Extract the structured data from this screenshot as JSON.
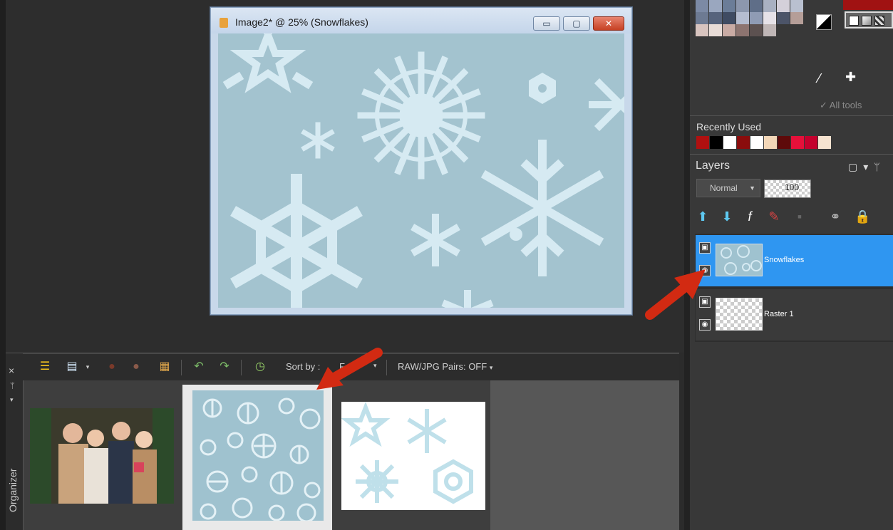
{
  "image_window": {
    "title": "Image2* @  25% (Snowflakes)",
    "min_glyph": "▭",
    "max_glyph": "▢",
    "close_glyph": "✕"
  },
  "palette": {
    "swatches": [
      "#7c8aa5",
      "#9aa7bf",
      "#6b7d98",
      "#8c97ad",
      "#5f6e88",
      "#a9b1c2",
      "#d4d0da",
      "#b9c0d0",
      "#6d7a92",
      "#56637c",
      "#3f4b62",
      "#b5bdd0",
      "#8f9bb4",
      "#e6e2e8",
      "#4c5468",
      "#b59e98",
      "#d8c4bf",
      "#e8dcd7",
      "#c9aba4",
      "#8d7470",
      "#5c5150",
      "#bfb6b6"
    ],
    "accent": "#a01212"
  },
  "tools": {
    "all_tools_label": "All tools"
  },
  "recently_used": {
    "label": "Recently Used",
    "colors": [
      "#b01010",
      "#000000",
      "#ffffff",
      "#8a0d0d",
      "#ffffff",
      "#f3d7b8",
      "#5e0a0a",
      "#e5103a",
      "#c4002d",
      "#f6e3d0"
    ]
  },
  "layers": {
    "title": "Layers",
    "blend_mode": "Normal",
    "opacity": "100",
    "items": [
      {
        "name": "Snowflakes",
        "selected": true
      },
      {
        "name": "Raster 1",
        "selected": false
      }
    ]
  },
  "organizer": {
    "label": "Organizer",
    "close": "×",
    "pin": "ᛘ",
    "menu": "▾",
    "sort_by_label": "Sort by :",
    "sort_by_value": "F",
    "raw_jpg_pairs": "RAW/JPG Pairs: OFF",
    "dropdown": "▾"
  },
  "colors": {
    "selection_blue": "#2f96f1",
    "snow_bg": "#a3c3cf",
    "snow_fg": "#d6eaf2",
    "arrow_red": "#d22a12"
  }
}
